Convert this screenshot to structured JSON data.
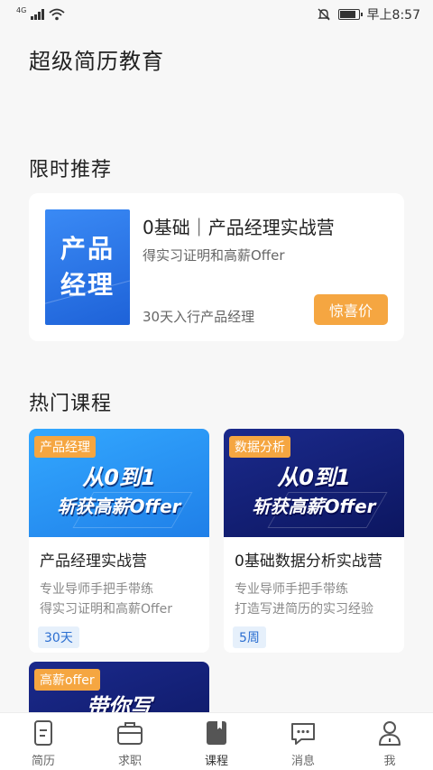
{
  "status": {
    "network": "4G",
    "time": "早上8:57"
  },
  "app_title": "超级简历教育",
  "recommend": {
    "section_title": "限时推荐",
    "cover_lines": [
      "产品",
      "经理"
    ],
    "title": "0基础｜产品经理实战营",
    "subtitle": "得实习证明和高薪Offer",
    "note": "30天入行产品经理",
    "button": "惊喜价"
  },
  "hot": {
    "section_title": "热门课程",
    "courses": [
      {
        "tag": "产品经理",
        "banner_line1": "从0到1",
        "banner_line2": "斩获高薪Offer",
        "title": "产品经理实战营",
        "desc1": "专业导师手把手带练",
        "desc2": "得实习证明和高薪Offer",
        "duration": "30天"
      },
      {
        "tag": "数据分析",
        "banner_line1": "从0到1",
        "banner_line2": "斩获高薪Offer",
        "title": "0基础数据分析实战营",
        "desc1": "专业导师手把手带练",
        "desc2": "打造写进简历的实习经验",
        "duration": "5周"
      },
      {
        "tag": "高薪offer",
        "banner_line1": "带你写"
      }
    ]
  },
  "tabs": [
    {
      "label": "简历",
      "icon": "resume-icon"
    },
    {
      "label": "求职",
      "icon": "briefcase-icon"
    },
    {
      "label": "课程",
      "icon": "book-icon",
      "active": true
    },
    {
      "label": "消息",
      "icon": "message-icon"
    },
    {
      "label": "我",
      "icon": "user-icon"
    }
  ]
}
